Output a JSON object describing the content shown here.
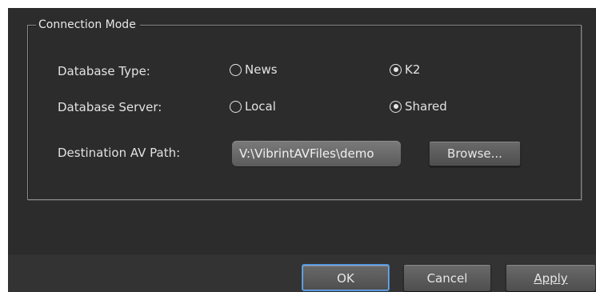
{
  "connection_mode": {
    "legend": "Connection Mode",
    "database_type": {
      "label": "Database Type:",
      "options": [
        {
          "label": "News",
          "selected": false
        },
        {
          "label": "K2",
          "selected": true
        }
      ]
    },
    "database_server": {
      "label": "Database Server:",
      "options": [
        {
          "label": "Local",
          "selected": false
        },
        {
          "label": "Shared",
          "selected": true
        }
      ]
    },
    "destination_path": {
      "label": "Destination AV Path:",
      "value": "V:\\VibrintAVFiles\\demo",
      "browse_label": "Browse..."
    }
  },
  "footer": {
    "ok_label": "OK",
    "cancel_label": "Cancel",
    "apply_label": "Apply"
  },
  "colors": {
    "background": "#2c2c2c",
    "text": "#e2e2e2",
    "focus_border": "#4a8fd8"
  },
  "icons": {
    "radio_selected": "radio-selected-icon",
    "radio_unselected": "radio-unselected-icon"
  }
}
